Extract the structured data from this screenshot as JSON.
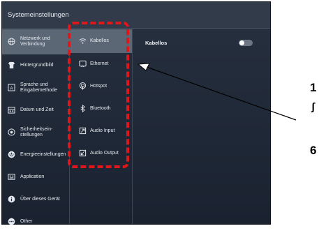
{
  "window": {
    "title": "Systemeinstellungen"
  },
  "sidebar": {
    "items": [
      {
        "label": "Netzwerk und Verbindung",
        "icon": "globe-icon",
        "selected": true
      },
      {
        "label": "Hintergrundbild",
        "icon": "shirt-icon",
        "selected": false
      },
      {
        "label": "Sprache und Eingabemethode",
        "icon": "keyboard-letter-icon",
        "selected": false
      },
      {
        "label": "Datum und Zeit",
        "icon": "calendar-icon",
        "selected": false
      },
      {
        "label": "Sicherheitsein-stellungen",
        "icon": "security-icon",
        "selected": false
      },
      {
        "label": "Energieeinstellungen",
        "icon": "power-icon",
        "selected": false
      },
      {
        "label": "Application",
        "icon": "app-grid-icon",
        "selected": false
      },
      {
        "label": "Über dieses Gerät",
        "icon": "info-icon",
        "selected": false
      },
      {
        "label": "Other",
        "icon": "more-icon",
        "selected": false
      }
    ]
  },
  "network_menu": {
    "items": [
      {
        "label": "Kabellos",
        "icon": "wifi-icon",
        "selected": true
      },
      {
        "label": "Ethernet",
        "icon": "ethernet-icon",
        "selected": false
      },
      {
        "label": "Hotspot",
        "icon": "hotspot-icon",
        "selected": false
      },
      {
        "label": "Bluetooth",
        "icon": "bluetooth-icon",
        "selected": false
      },
      {
        "label": "Audio Input",
        "icon": "audio-input-icon",
        "selected": false
      },
      {
        "label": "Audio Output",
        "icon": "audio-output-icon",
        "selected": false
      }
    ]
  },
  "detail": {
    "label": "Kabellos",
    "toggle_on": false
  },
  "annotation": {
    "side_texts": [
      "1",
      "ʃ",
      "6"
    ],
    "colors": {
      "box": "#e0161d",
      "arrow": "#000000"
    }
  }
}
